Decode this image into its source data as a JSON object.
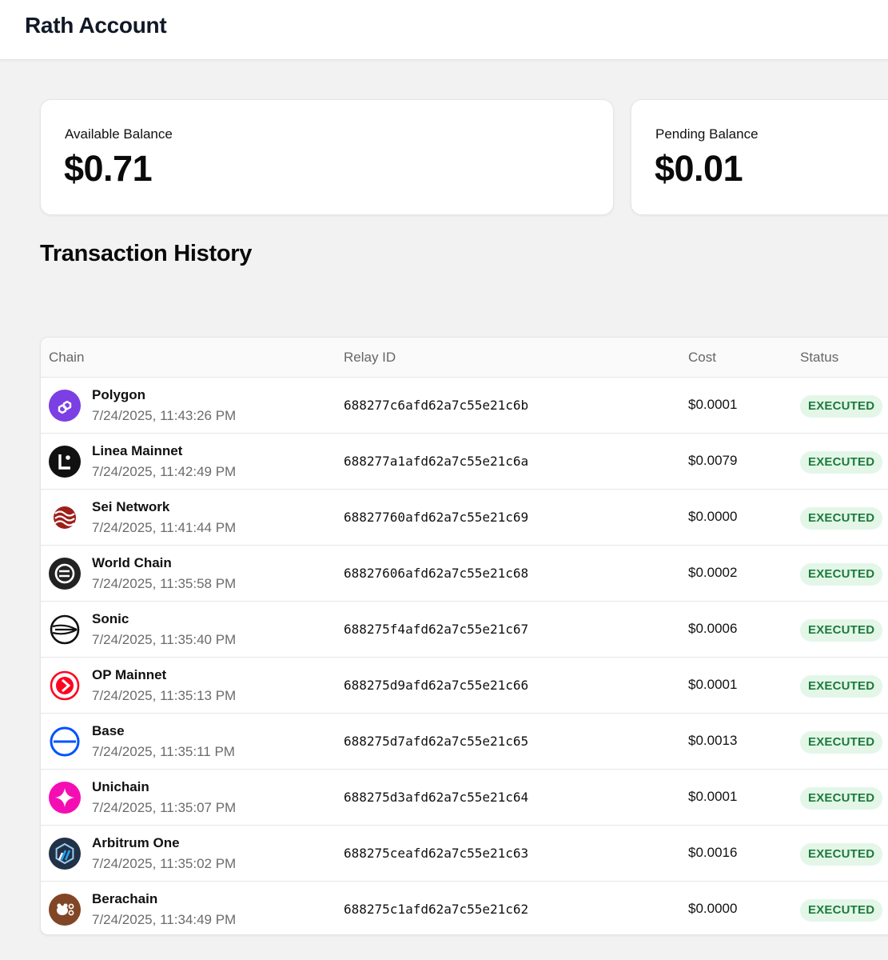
{
  "app": {
    "title": "Rath Account"
  },
  "balances": {
    "available": {
      "label": "Available Balance",
      "value": "$0.71"
    },
    "pending": {
      "label": "Pending Balance",
      "value": "$0.01"
    }
  },
  "transactions": {
    "title": "Transaction History",
    "columns": {
      "chain": "Chain",
      "relay_id": "Relay ID",
      "cost": "Cost",
      "status": "Status"
    },
    "rows": [
      {
        "chain": "Polygon",
        "date": "7/24/2025, 11:43:26 PM",
        "relay_id": "688277c6afd62a7c55e21c6b",
        "cost": "$0.0001",
        "status": "EXECUTED",
        "icon": "polygon-icon"
      },
      {
        "chain": "Linea Mainnet",
        "date": "7/24/2025, 11:42:49 PM",
        "relay_id": "688277a1afd62a7c55e21c6a",
        "cost": "$0.0079",
        "status": "EXECUTED",
        "icon": "linea-icon"
      },
      {
        "chain": "Sei Network",
        "date": "7/24/2025, 11:41:44 PM",
        "relay_id": "68827760afd62a7c55e21c69",
        "cost": "$0.0000",
        "status": "EXECUTED",
        "icon": "sei-icon"
      },
      {
        "chain": "World Chain",
        "date": "7/24/2025, 11:35:58 PM",
        "relay_id": "68827606afd62a7c55e21c68",
        "cost": "$0.0002",
        "status": "EXECUTED",
        "icon": "world-chain-icon"
      },
      {
        "chain": "Sonic",
        "date": "7/24/2025, 11:35:40 PM",
        "relay_id": "688275f4afd62a7c55e21c67",
        "cost": "$0.0006",
        "status": "EXECUTED",
        "icon": "sonic-icon"
      },
      {
        "chain": "OP Mainnet",
        "date": "7/24/2025, 11:35:13 PM",
        "relay_id": "688275d9afd62a7c55e21c66",
        "cost": "$0.0001",
        "status": "EXECUTED",
        "icon": "op-icon"
      },
      {
        "chain": "Base",
        "date": "7/24/2025, 11:35:11 PM",
        "relay_id": "688275d7afd62a7c55e21c65",
        "cost": "$0.0013",
        "status": "EXECUTED",
        "icon": "base-icon"
      },
      {
        "chain": "Unichain",
        "date": "7/24/2025, 11:35:07 PM",
        "relay_id": "688275d3afd62a7c55e21c64",
        "cost": "$0.0001",
        "status": "EXECUTED",
        "icon": "unichain-icon"
      },
      {
        "chain": "Arbitrum One",
        "date": "7/24/2025, 11:35:02 PM",
        "relay_id": "688275ceafd62a7c55e21c63",
        "cost": "$0.0016",
        "status": "EXECUTED",
        "icon": "arbitrum-icon"
      },
      {
        "chain": "Berachain",
        "date": "7/24/2025, 11:34:49 PM",
        "relay_id": "688275c1afd62a7c55e21c62",
        "cost": "$0.0000",
        "status": "EXECUTED",
        "icon": "berachain-icon"
      }
    ]
  },
  "colors": {
    "status_bg": "#e3f6e8",
    "status_text": "#1e7b3a",
    "polygon": "#7b3fe4",
    "op": "#ff0420",
    "base": "#0052ff",
    "unichain": "#f50db4",
    "arbitrum": "#213147",
    "berachain": "#814625",
    "sei": "#9e1f19"
  }
}
